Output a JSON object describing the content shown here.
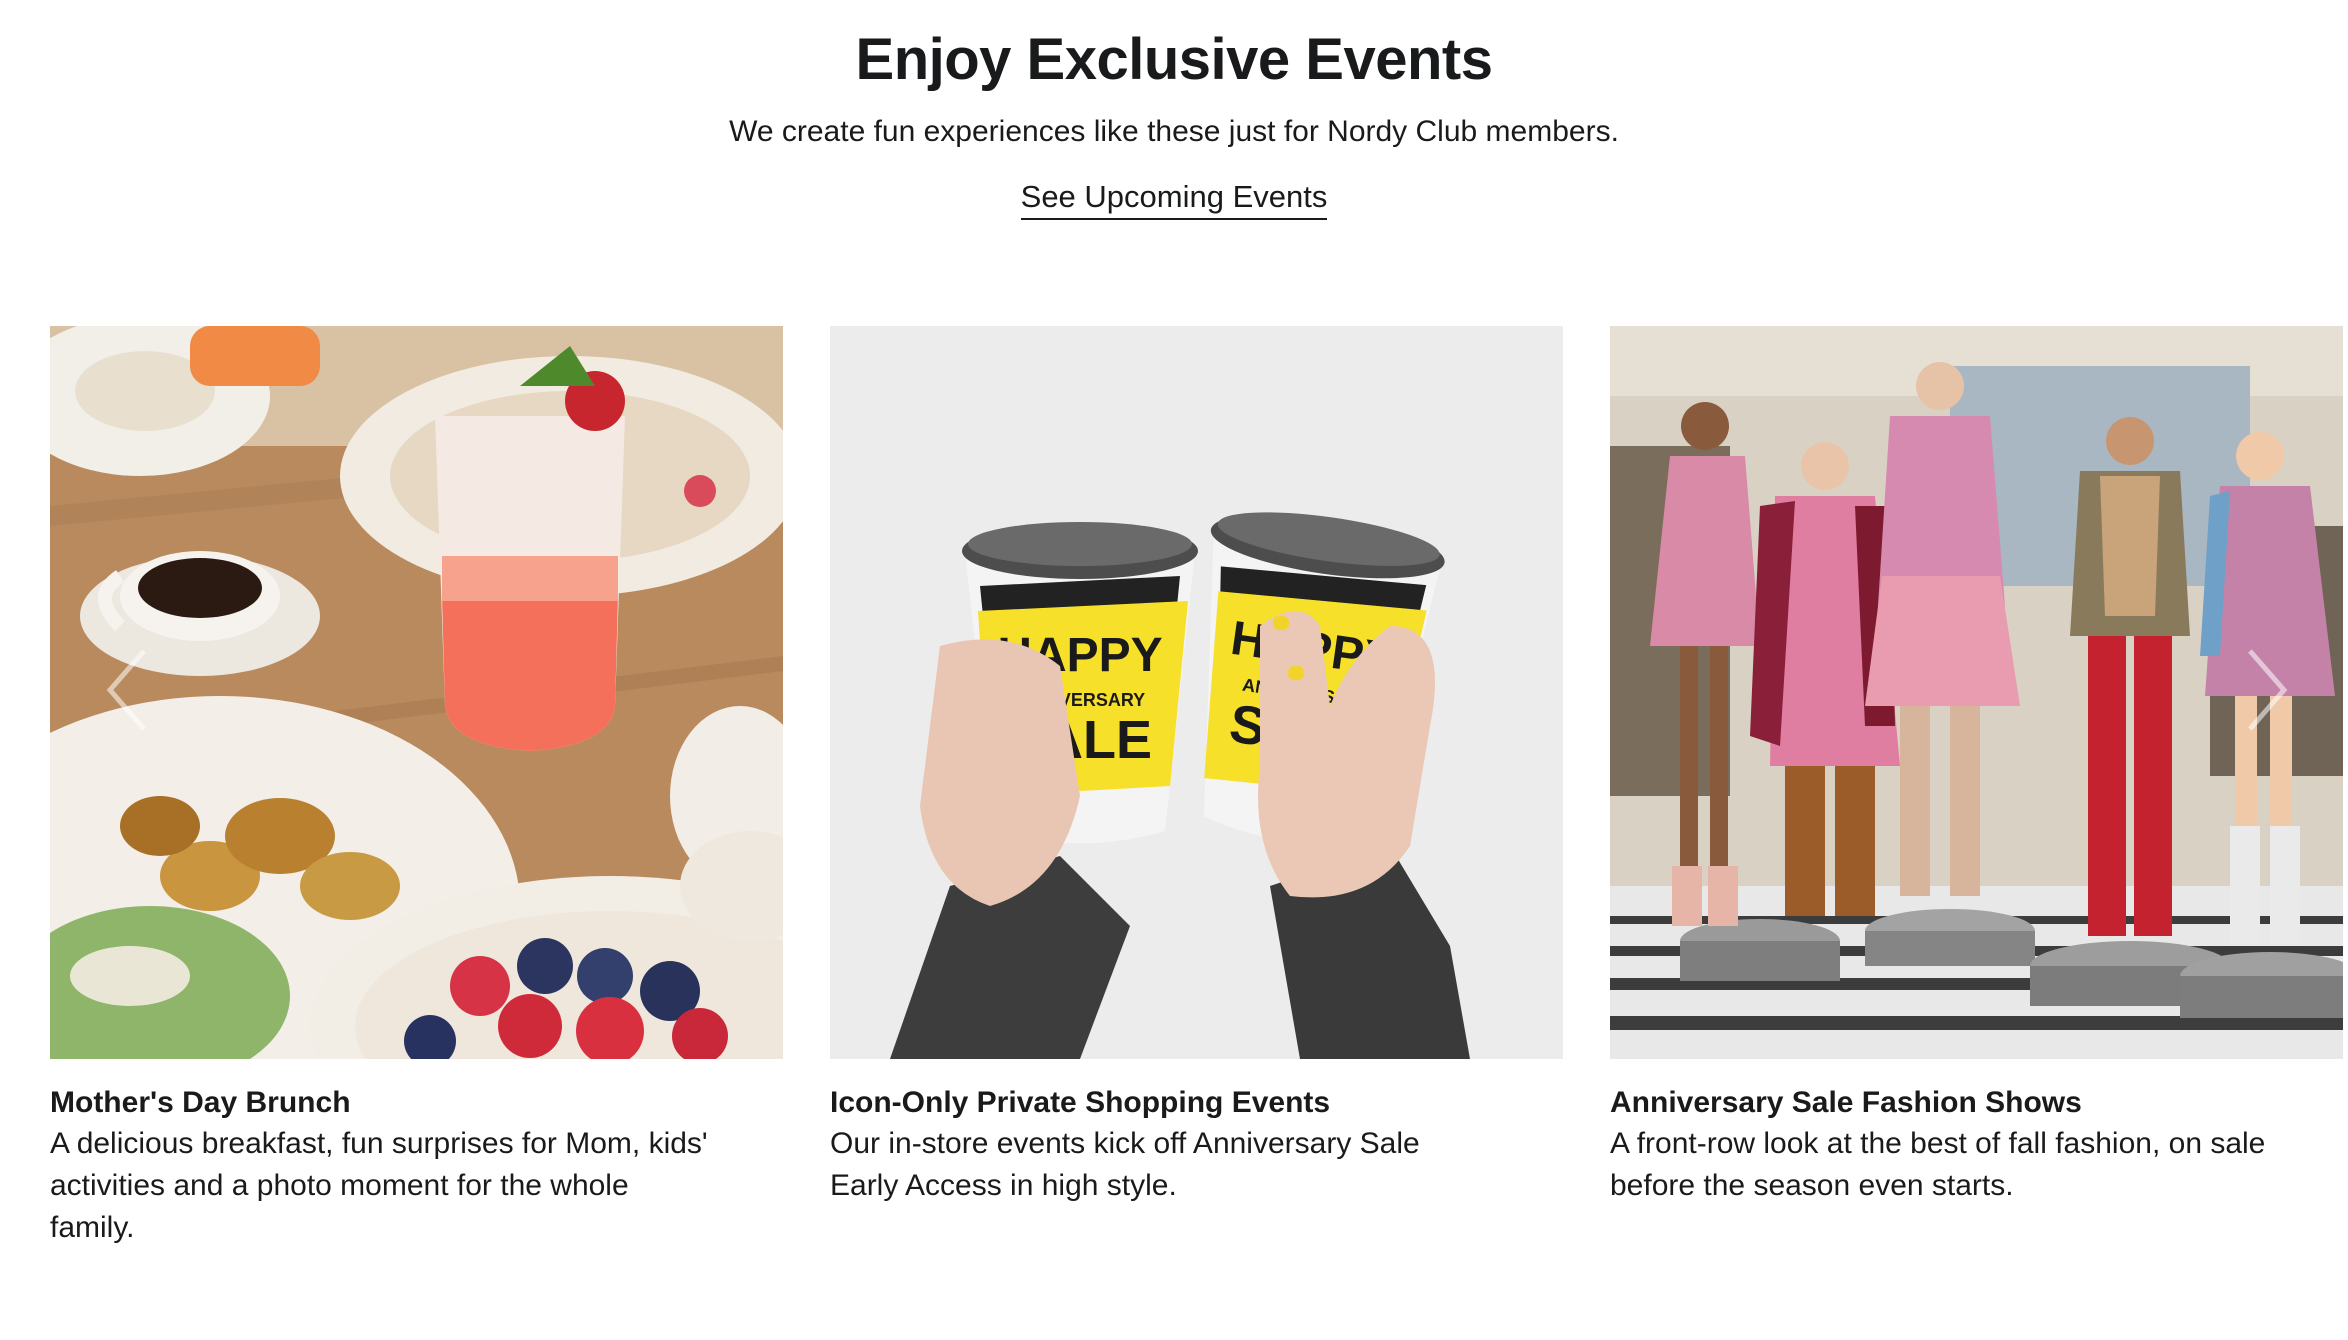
{
  "section": {
    "title": "Enjoy Exclusive Events",
    "subtitle": "We create fun experiences like these just for Nordy Club members.",
    "cta_label": "See Upcoming Events"
  },
  "cards": [
    {
      "title": "Mother's Day Brunch",
      "description": "A delicious breakfast, fun surprises for Mom, kids' activities and a photo moment for the whole family.",
      "image_icon": "brunch-photo"
    },
    {
      "title": "Icon-Only Private Shopping Events",
      "description": "Our in-store events kick off Anniversary Sale Early Access in high style.",
      "image_icon": "coffee-cups-photo",
      "cup_text": {
        "line1": "HAPPY",
        "line2": "ANNIVERSARY",
        "line3": "SALE"
      }
    },
    {
      "title": "Anniversary Sale Fashion Shows",
      "description": "A front-row look at the best of fall fashion, on sale before the season even starts.",
      "image_icon": "fashion-show-photo"
    }
  ],
  "carousel": {
    "prev_icon": "chevron-left-icon",
    "next_icon": "chevron-right-icon"
  }
}
